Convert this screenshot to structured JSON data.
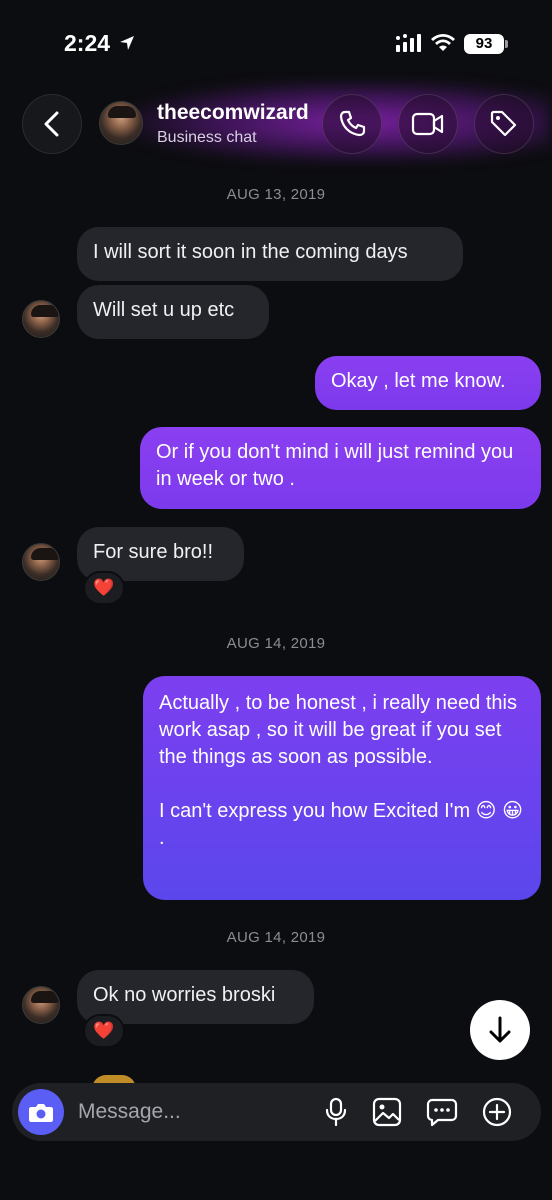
{
  "status": {
    "time": "2:24",
    "battery": "93"
  },
  "header": {
    "name": "theecomwizard",
    "subtitle": "Business chat"
  },
  "messages": {
    "date1": "AUG 13, 2019",
    "m1": "I will sort it soon in the coming days",
    "m2": "Will set u up etc",
    "m3": "Okay , let me know.",
    "m4": "Or if you don't mind i will just remind you in week or two .",
    "m5": "For sure bro!!",
    "m5_reaction": "❤️",
    "date2": "AUG 14, 2019",
    "m6": "Actually , to be honest , i really need this work asap , so it will be great if you set the things as soon as possible.\n\nI can't express you how Excited I'm 😊 😀 .",
    "date3": "AUG 14, 2019",
    "m7": "Ok no worries broski",
    "m7_reaction": "❤️"
  },
  "composer": {
    "placeholder": "Message..."
  },
  "icons": {
    "back": "chevron-left-icon",
    "call": "phone-icon",
    "video": "video-camera-icon",
    "tag": "tag-icon",
    "camera": "camera-icon",
    "mic": "microphone-icon",
    "gallery": "image-icon",
    "sticker": "chat-bubble-icon",
    "add": "plus-circle-icon",
    "scroll_down": "arrow-down-icon"
  },
  "colors": {
    "background": "#0c0d10",
    "incoming_bubble": "#25262b",
    "outgoing_bubble": "#7c3aed",
    "accent": "#5b5ef5"
  }
}
